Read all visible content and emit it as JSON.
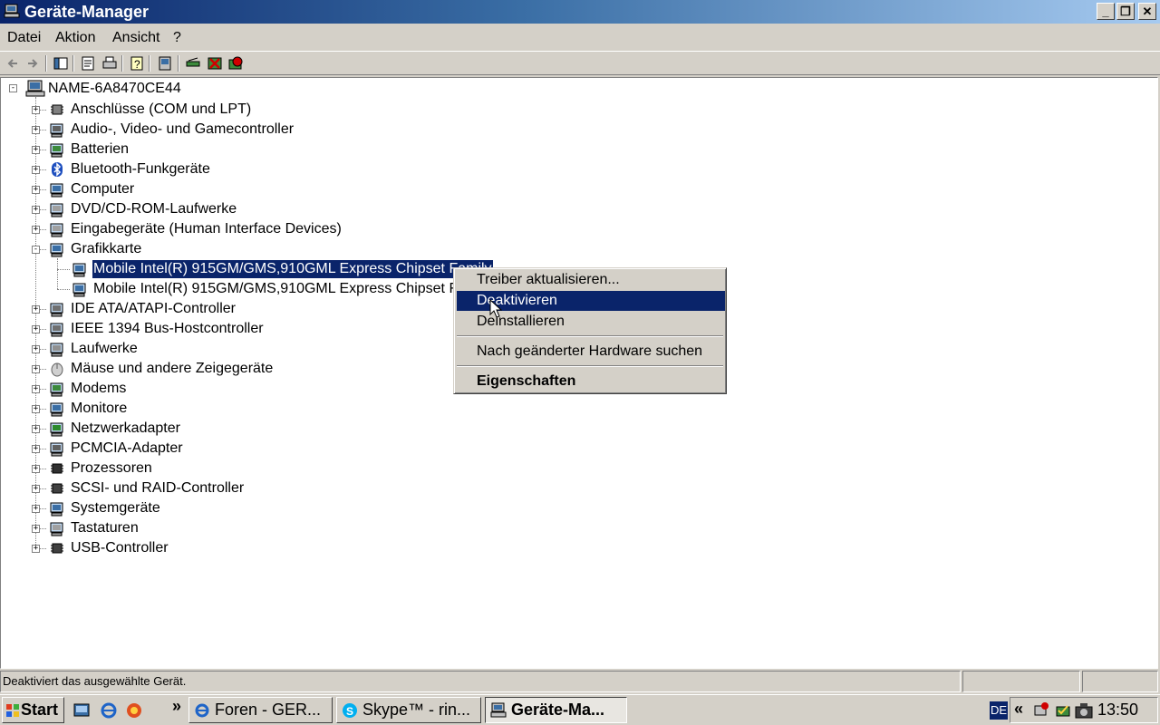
{
  "window": {
    "title": "Geräte-Manager",
    "minimize": "_",
    "restore": "❐",
    "close": "✕"
  },
  "menu": [
    "Datei",
    "Aktion",
    "Ansicht",
    "?"
  ],
  "tree": {
    "root": "NAME-6A8470CE44",
    "categories": [
      {
        "label": "Anschlüsse (COM und LPT)",
        "icon": "port-icon"
      },
      {
        "label": "Audio-, Video- und Gamecontroller",
        "icon": "speaker-icon"
      },
      {
        "label": "Batterien",
        "icon": "battery-icon"
      },
      {
        "label": "Bluetooth-Funkgeräte",
        "icon": "bluetooth-icon"
      },
      {
        "label": "Computer",
        "icon": "computer-icon"
      },
      {
        "label": "DVD/CD-ROM-Laufwerke",
        "icon": "cdrom-icon"
      },
      {
        "label": "Eingabegeräte (Human Interface Devices)",
        "icon": "keyboard-icon"
      },
      {
        "label": "Grafikkarte",
        "icon": "display-adapter-icon",
        "expanded": true,
        "children": [
          {
            "label": "Mobile Intel(R) 915GM/GMS,910GML Express Chipset Family",
            "selected": true
          },
          {
            "label": "Mobile Intel(R) 915GM/GMS,910GML Express Chipset Family",
            "selected": false
          }
        ]
      },
      {
        "label": "IDE ATA/ATAPI-Controller",
        "icon": "ide-icon"
      },
      {
        "label": "IEEE 1394 Bus-Hostcontroller",
        "icon": "firewire-icon"
      },
      {
        "label": "Laufwerke",
        "icon": "disk-drive-icon"
      },
      {
        "label": "Mäuse und andere Zeigegeräte",
        "icon": "mouse-icon"
      },
      {
        "label": "Modems",
        "icon": "modem-icon"
      },
      {
        "label": "Monitore",
        "icon": "monitor-icon"
      },
      {
        "label": "Netzwerkadapter",
        "icon": "network-card-icon"
      },
      {
        "label": "PCMCIA-Adapter",
        "icon": "pcmcia-icon"
      },
      {
        "label": "Prozessoren",
        "icon": "processor-icon"
      },
      {
        "label": "SCSI- und RAID-Controller",
        "icon": "scsi-icon"
      },
      {
        "label": "Systemgeräte",
        "icon": "system-device-icon"
      },
      {
        "label": "Tastaturen",
        "icon": "keyboard-icon"
      },
      {
        "label": "USB-Controller",
        "icon": "usb-icon"
      }
    ]
  },
  "context_menu": {
    "items": [
      {
        "label": "Treiber aktualisieren...",
        "highlighted": false,
        "bold": false
      },
      {
        "label": "Deaktivieren",
        "highlighted": true,
        "bold": false
      },
      {
        "label": "Deinstallieren",
        "highlighted": false,
        "bold": false
      },
      {
        "label": "Nach geänderter Hardware suchen",
        "highlighted": false,
        "bold": false
      },
      {
        "label": "Eigenschaften",
        "highlighted": false,
        "bold": true
      }
    ]
  },
  "status": {
    "text": "Deaktiviert das ausgewählte Gerät."
  },
  "taskbar": {
    "start": "Start",
    "chevron": "»",
    "tasks": [
      {
        "label": "Foren - GER...",
        "icon": "ie-icon",
        "active": false
      },
      {
        "label": "Skype™ - rin...",
        "icon": "skype-icon",
        "active": false
      },
      {
        "label": "Geräte-Ma...",
        "icon": "device-manager-icon",
        "active": true
      }
    ],
    "language": "DE",
    "tray_chevron": "«",
    "clock": "13:50"
  }
}
